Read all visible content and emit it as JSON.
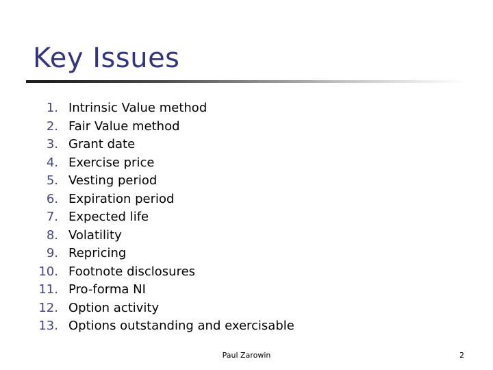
{
  "slide": {
    "title": "Key Issues",
    "title_color": "#35357e",
    "number_color": "#45457f",
    "text_color": "#000000",
    "background_color": "#ffffff",
    "rule": {
      "start_color": "#1a1a1a",
      "end_color": "#ffffff"
    },
    "items": [
      {
        "number": "1.",
        "label": "Intrinsic Value method"
      },
      {
        "number": "2.",
        "label": "Fair Value method"
      },
      {
        "number": "3.",
        "label": "Grant date"
      },
      {
        "number": "4.",
        "label": "Exercise price"
      },
      {
        "number": "5.",
        "label": "Vesting period"
      },
      {
        "number": "6.",
        "label": "Expiration period"
      },
      {
        "number": "7.",
        "label": "Expected life"
      },
      {
        "number": "8.",
        "label": "Volatility"
      },
      {
        "number": "9.",
        "label": "Repricing"
      },
      {
        "number": "10.",
        "label": "Footnote disclosures"
      },
      {
        "number": "11.",
        "label": "Pro-forma NI"
      },
      {
        "number": "12.",
        "label": "Option activity"
      },
      {
        "number": "13.",
        "label": "Options outstanding and exercisable"
      }
    ],
    "footer": {
      "author": "Paul Zarowin",
      "page_number": "2"
    }
  }
}
